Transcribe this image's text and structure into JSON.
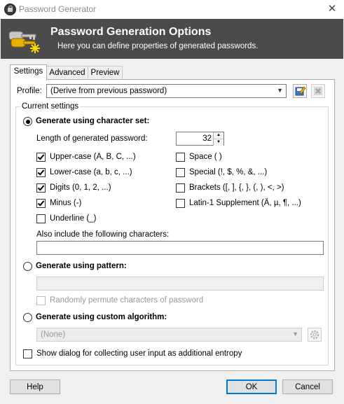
{
  "window": {
    "title": "Password Generator"
  },
  "banner": {
    "title": "Password Generation Options",
    "subtitle": "Here you can define properties of generated passwords."
  },
  "tabs": [
    {
      "label": "Settings",
      "active": true
    },
    {
      "label": "Advanced",
      "active": false
    },
    {
      "label": "Preview",
      "active": false
    }
  ],
  "profile": {
    "label": "Profile:",
    "value": "(Derive from previous password)"
  },
  "current_settings": {
    "group_label": "Current settings",
    "charset_radio": {
      "label": "Generate using character set:",
      "checked": true
    },
    "length": {
      "label": "Length of generated password:",
      "value": "32"
    },
    "charsets": [
      {
        "label": "Upper-case (A, B, C, ...)",
        "checked": true
      },
      {
        "label": "Lower-case (a, b, c, ...)",
        "checked": true
      },
      {
        "label": "Digits (0, 1, 2, ...)",
        "checked": true
      },
      {
        "label": "Minus (-)",
        "checked": true
      },
      {
        "label": "Underline (_)",
        "checked": false
      },
      {
        "label": "Space ( )",
        "checked": false
      },
      {
        "label": "Special (!, $, %, &, ...)",
        "checked": false
      },
      {
        "label": "Brackets ([, ], {, }, (, ), <, >)",
        "checked": false
      },
      {
        "label": "Latin-1 Supplement (Ä, µ, ¶, ...)",
        "checked": false
      }
    ],
    "also_include": {
      "label": "Also include the following characters:",
      "value": ""
    },
    "pattern_radio": {
      "label": "Generate using pattern:",
      "checked": false
    },
    "pattern_value": "",
    "permute": {
      "label": "Randomly permute characters of password",
      "checked": false
    },
    "custom_radio": {
      "label": "Generate using custom algorithm:",
      "checked": false
    },
    "custom_value": "(None)",
    "entropy": {
      "label": "Show dialog for collecting user input as additional entropy",
      "checked": false
    }
  },
  "buttons": {
    "help": "Help",
    "ok": "OK",
    "cancel": "Cancel"
  },
  "colors": {
    "banner_bg": "#4b4b4b",
    "accent": "#0078d7"
  }
}
